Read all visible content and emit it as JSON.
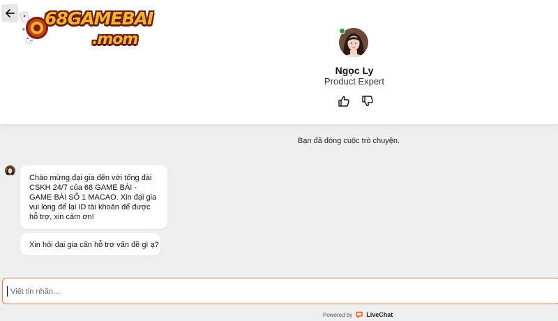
{
  "header": {
    "logo": {
      "top_text": "68GAMEBAI",
      "bottom_text": ".mom"
    },
    "agent": {
      "name": "Ngọc Ly",
      "title": "Product Expert",
      "status_color": "#2a9d3c"
    }
  },
  "chat": {
    "system_message": "Bạn đã đóng cuộc trò chuyện.",
    "messages": [
      "Chào mừng đại gia đến với tổng đài CSKH 24/7 của 68 GAME BÀI - GAME BÀI SỐ 1 MACAO. Xin đại gia vui lòng để lại ID tài khoản để được hỗ trợ, xin cảm ơn!",
      "Xin hỏi đại gia cần hỗ trợ vấn đề gì ạ?"
    ]
  },
  "composer": {
    "placeholder": "Viết tin nhắn...",
    "accent_color": "#e0734a"
  },
  "footer": {
    "powered_by": "Powered by",
    "brand": "LiveChat"
  },
  "icons": {
    "back": "arrow-left-icon",
    "thumbs_up": "thumbs-up-icon",
    "thumbs_down": "thumbs-down-icon",
    "livechat": "livechat-logo-icon"
  }
}
